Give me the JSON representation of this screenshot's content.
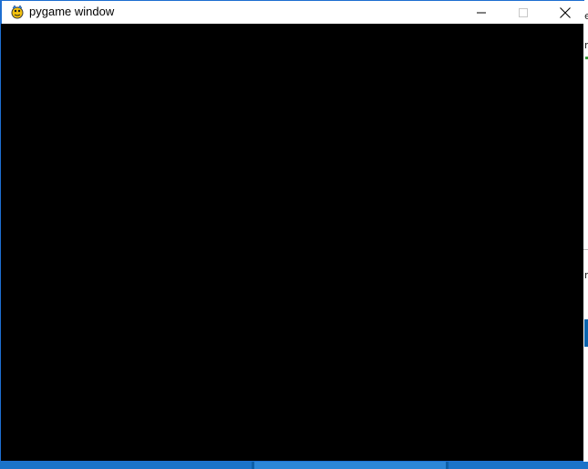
{
  "window": {
    "title": "pygame window",
    "icon": "pygame-snake-icon",
    "controls": {
      "minimize_icon": "minimize-icon",
      "maximize_icon": "maximize-icon",
      "close_icon": "close-icon"
    }
  },
  "canvas": {
    "background": "#000000"
  },
  "colors": {
    "window_border": "#1e6fd1",
    "titlebar": "#ffffff",
    "taskbar": "#0c5ea8"
  },
  "background_window": {
    "visible_chars": [
      "e",
      "r",
      "r"
    ]
  }
}
